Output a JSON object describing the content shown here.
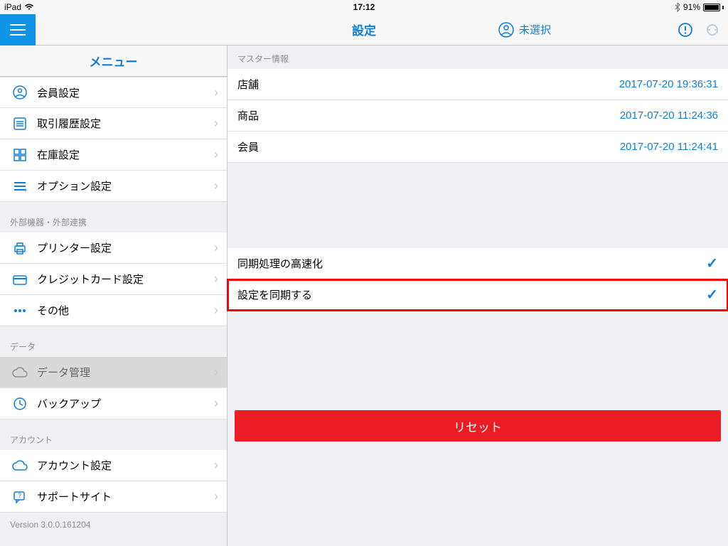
{
  "statusbar": {
    "device": "iPad",
    "time": "17:12",
    "battery_pct": "91%"
  },
  "navbar": {
    "title": "設定",
    "user_status": "未選択"
  },
  "sidebar": {
    "menu_title": "メニュー",
    "group1": {
      "items": [
        {
          "label": "会員設定"
        },
        {
          "label": "取引履歴設定"
        },
        {
          "label": "在庫設定"
        },
        {
          "label": "オプション設定"
        }
      ]
    },
    "group2": {
      "header": "外部機器・外部連携",
      "items": [
        {
          "label": "プリンター設定"
        },
        {
          "label": "クレジットカード設定"
        },
        {
          "label": "その他"
        }
      ]
    },
    "group3": {
      "header": "データ",
      "items": [
        {
          "label": "データ管理"
        },
        {
          "label": "バックアップ"
        }
      ]
    },
    "group4": {
      "header": "アカウント",
      "items": [
        {
          "label": "アカウント設定"
        },
        {
          "label": "サポートサイト"
        }
      ]
    },
    "version": "Version 3.0.0.161204"
  },
  "content": {
    "master_header": "マスター情報",
    "master": [
      {
        "label": "店舗",
        "value": "2017-07-20 19:36:31"
      },
      {
        "label": "商品",
        "value": "2017-07-20 11:24:36"
      },
      {
        "label": "会員",
        "value": "2017-07-20 11:24:41"
      }
    ],
    "sync": [
      {
        "label": "同期処理の高速化"
      },
      {
        "label": "設定を同期する"
      }
    ],
    "reset_label": "リセット"
  }
}
